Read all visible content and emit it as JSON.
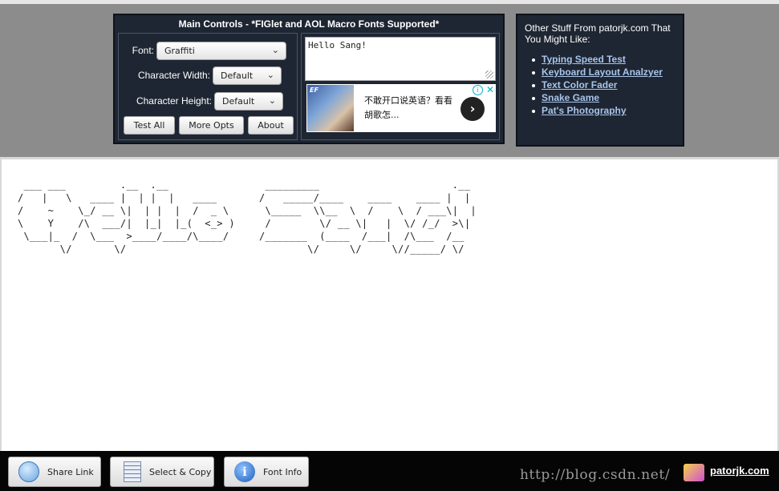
{
  "main_controls": {
    "title": "Main Controls - *FIGlet and AOL Macro Fonts Supported*",
    "font_label": "Font:",
    "font_value": "Graffiti",
    "char_width_label": "Character Width:",
    "char_width_value": "Default",
    "char_height_label": "Character Height:",
    "char_height_value": "Default",
    "buttons": {
      "test_all": "Test All",
      "more_opts": "More Opts",
      "about": "About"
    },
    "input_text": "Hello Sang!"
  },
  "ad": {
    "badge": "EF",
    "text": "不敢开口说英语？看看胡歌怎...",
    "arrow": "›",
    "info": "i",
    "close": "✕"
  },
  "other_stuff": {
    "title": "Other Stuff From patorjk.com That You Might Like:",
    "links": [
      "Typing Speed Test",
      "Keyboard Layout Analzyer",
      "Text Color Fader",
      "Snake Game",
      "Pat's Photography"
    ]
  },
  "output": {
    "ascii_lines": [
      " ___ ___         .__  .__                _________                      .__",
      "/   |   \\   ____ |  | |  |   ____       /   _____/____    ____    ____ |  |",
      "/    ~    \\_/ __ \\|  | |  |  /  _ \\      \\_____  \\\\__  \\  /    \\  / ___\\|  |",
      "\\    Y    /\\  ___/|  |_|  |_(  <_> )     /        \\/ __ \\|   |  \\/ /_/  >\\|",
      " \\___|_  /  \\___  >____/____/\\____/     /_______  (____  /___|  /\\___  /__",
      "       \\/       \\/                              \\/     \\/     \\//_____/ \\/"
    ]
  },
  "bottom_bar": {
    "share_link": "Share Link",
    "select_copy": "Select & Copy",
    "font_info": "Font Info",
    "info_glyph": "i",
    "watermark": "http://blog.csdn.net/",
    "brand": "patorjk.com"
  }
}
